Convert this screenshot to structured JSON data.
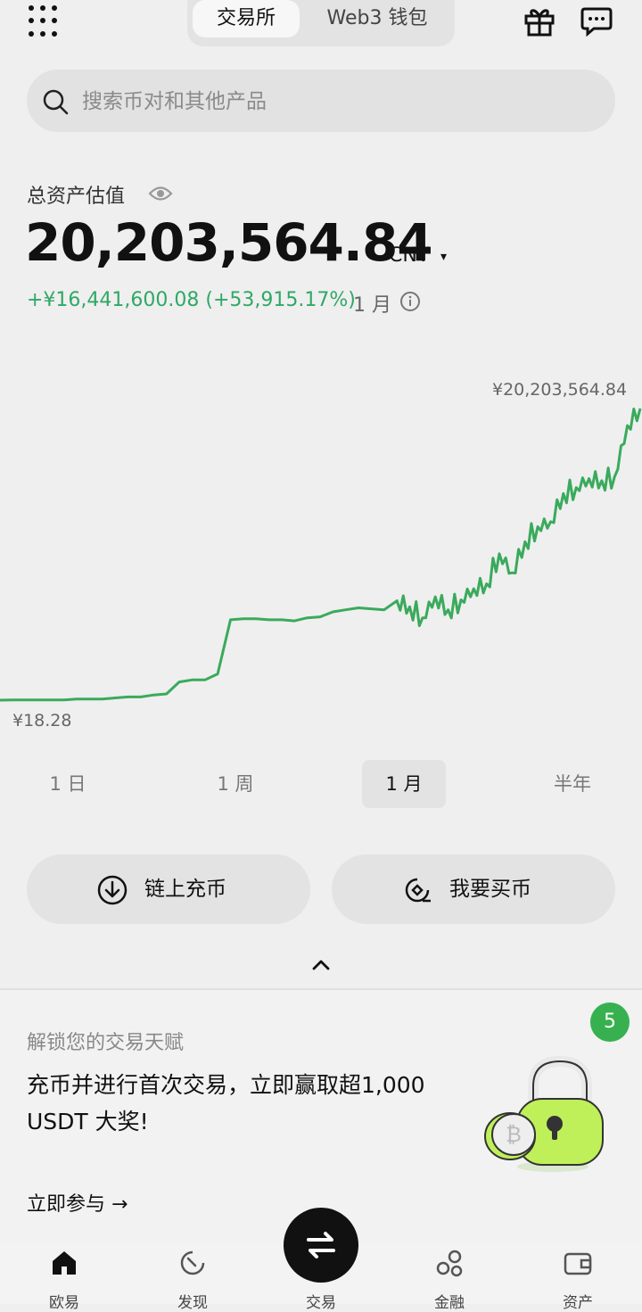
{
  "header": {
    "tabs": [
      {
        "label": "交易所",
        "active": true
      },
      {
        "label": "Web3 钱包",
        "active": false
      }
    ],
    "icons": [
      "grid-menu-icon",
      "gift-icon",
      "message-icon"
    ]
  },
  "search": {
    "placeholder": "搜索币对和其他产品"
  },
  "assets": {
    "label": "总资产估值",
    "value": "20,203,564.84",
    "currency": "CNY",
    "caret": "▾",
    "pnl": "+¥16,441,600.08 (+53,915.17%)",
    "period": "1 月"
  },
  "chart_data": {
    "type": "line",
    "title": "",
    "max_label": "¥20,203,564.84",
    "min_label": "¥18.28",
    "color": "#3aaa5c",
    "grid": false,
    "x": [
      0,
      2,
      4,
      6,
      8,
      10,
      12,
      14,
      16,
      18,
      20,
      22,
      24,
      26,
      28,
      30,
      32,
      34,
      36,
      38,
      40,
      42,
      44,
      46,
      48,
      50,
      52,
      54,
      56,
      58,
      60,
      62,
      64,
      66,
      68,
      70,
      72,
      74,
      76,
      78,
      80,
      82,
      84,
      86,
      88,
      90,
      92,
      94,
      96,
      98,
      100
    ],
    "values": [
      18.28,
      18.3,
      18.3,
      18.3,
      18.3,
      18.3,
      18.4,
      18.4,
      18.4,
      18.5,
      18.6,
      18.6,
      18.8,
      18.9,
      20.1,
      20.3,
      20.3,
      20.9,
      26.3,
      26.4,
      26.4,
      26.3,
      26.3,
      26.2,
      26.5,
      26.6,
      27.1,
      27.3,
      27.5,
      27.4,
      27.3,
      28.2,
      27.6,
      26.5,
      28.6,
      27.3,
      28.3,
      29.4,
      29.9,
      32.9,
      31.0,
      34.1,
      35.6,
      36.1,
      38.9,
      39.5,
      40.4,
      40.2,
      40.6,
      45.7,
      47.4
    ],
    "values_note_units": "scaled index of portfolio value, min ¥18.28 to max ¥20,203,564.84 as displayed",
    "range_options": [
      "1 日",
      "1 周",
      "1 月",
      "半年"
    ],
    "selected_range": "1 月"
  },
  "actions": {
    "deposit": "链上充币",
    "buy": "我要买币"
  },
  "promo": {
    "badge": "5",
    "subtitle": "解锁您的交易天赋",
    "title": "充币并进行首次交易，立即赢取超1,000 USDT 大奖!",
    "cta": "立即参与 →"
  },
  "tabbar": {
    "items": [
      {
        "label": "欧易",
        "icon": "home-icon"
      },
      {
        "label": "发现",
        "icon": "discover-icon"
      },
      {
        "label": "交易",
        "icon": "swap-icon"
      },
      {
        "label": "金融",
        "icon": "finance-icon"
      },
      {
        "label": "资产",
        "icon": "wallet-icon"
      }
    ]
  },
  "colors": {
    "accent_green": "#3aaa5c",
    "badge_green": "#37b14f",
    "background": "#efefef"
  }
}
